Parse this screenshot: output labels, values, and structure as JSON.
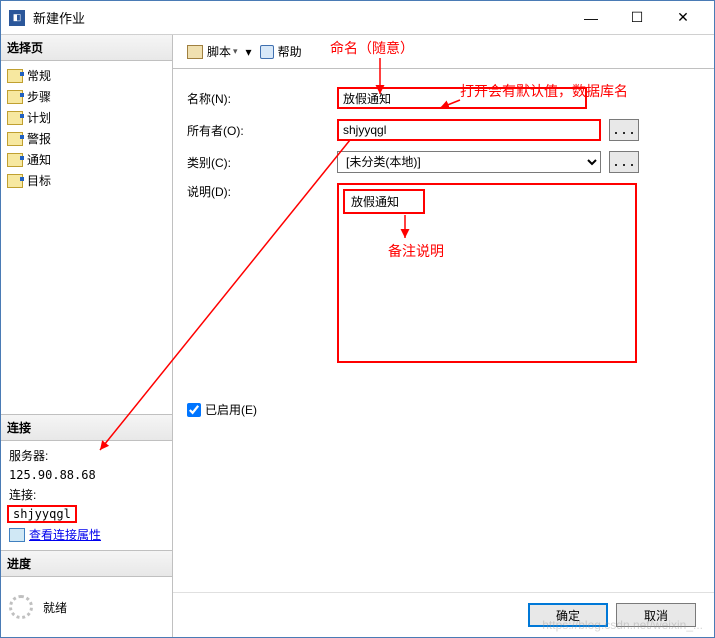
{
  "window": {
    "title": "新建作业",
    "minimize": "—",
    "maximize": "☐",
    "close": "✕"
  },
  "sidebar": {
    "selectHeader": "选择页",
    "nav": [
      {
        "label": "常规"
      },
      {
        "label": "步骤"
      },
      {
        "label": "计划"
      },
      {
        "label": "警报"
      },
      {
        "label": "通知"
      },
      {
        "label": "目标"
      }
    ],
    "connHeader": "连接",
    "serverLabel": "服务器:",
    "serverValue": "125.90.88.68",
    "connLabel": "连接:",
    "connValue": "shjyyqgl",
    "viewConnProps": "查看连接属性",
    "progressHeader": "进度",
    "progressStatus": "就绪"
  },
  "toolbar": {
    "script": "脚本",
    "help": "帮助"
  },
  "form": {
    "nameLabel": "名称(N):",
    "nameValue": "放假通知",
    "ownerLabel": "所有者(O):",
    "ownerValue": "shjyyqgl",
    "ownerBtn": "...",
    "categoryLabel": "类别(C):",
    "categoryValue": "[未分类(本地)]",
    "categoryBtn": "...",
    "descLabel": "说明(D):",
    "descValue": "放假通知",
    "enabledLabel": "已启用(E)"
  },
  "buttons": {
    "ok": "确定",
    "cancel": "取消"
  },
  "annotations": {
    "naming": "命名（随意）",
    "defaultVal": "打开会有默认值，数据库名",
    "remark": "备注说明"
  },
  "watermark": "https://blog.csdn.net/weixin_..."
}
